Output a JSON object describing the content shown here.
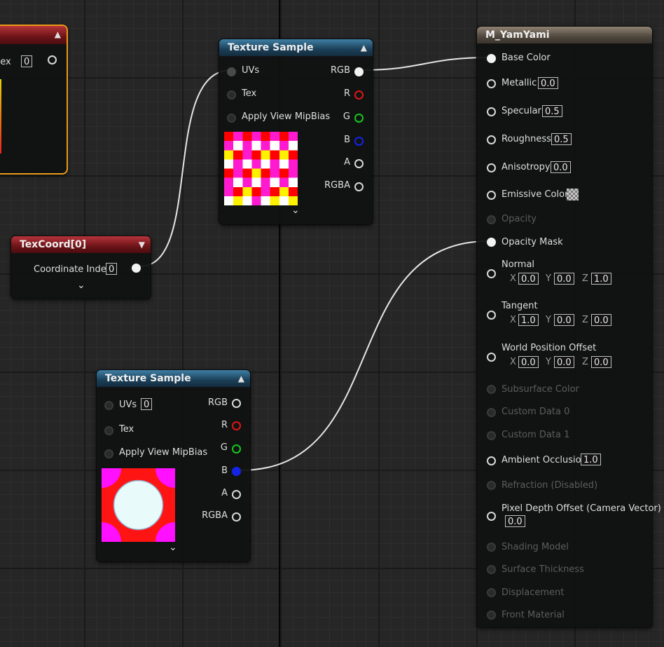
{
  "colors": {
    "grid_bg": "#262626",
    "texture_header": "#1b3f58",
    "texcoord_header": "#6c1418",
    "material_header": "#4f473e",
    "selection_outline": "#e89a1a",
    "pin_red": "#e01515",
    "pin_green": "#12c81e",
    "pin_blue": "#1424e6"
  },
  "partial_node": {
    "label_fragment": "dex",
    "value": "0"
  },
  "texture_sample_top": {
    "title": "Texture Sample",
    "inputs": [
      "UVs",
      "Tex",
      "Apply View MipBias"
    ],
    "outputs": [
      "RGB",
      "R",
      "G",
      "B",
      "A",
      "RGBA"
    ],
    "preview": "checker-pattern-red-magenta-yellow-white"
  },
  "texcoord_node": {
    "title": "TexCoord[0]",
    "label": "Coordinate Index",
    "value": "0"
  },
  "texture_sample_bottom": {
    "title": "Texture Sample",
    "inputs": [
      "UVs",
      "Tex",
      "Apply View MipBias"
    ],
    "uvs_value": "0",
    "outputs": [
      "RGB",
      "R",
      "G",
      "B",
      "A",
      "RGBA"
    ],
    "preview": "circle-pattern-red-magenta-white"
  },
  "material_node": {
    "title": "M_YamYami",
    "base_color": "Base Color",
    "metallic": {
      "label": "Metallic",
      "value": "0.0"
    },
    "specular": {
      "label": "Specular",
      "value": "0.5"
    },
    "roughness": {
      "label": "Roughness",
      "value": "0.5"
    },
    "anisotropy": {
      "label": "Anisotropy",
      "value": "0.0"
    },
    "emissive": "Emissive Color",
    "opacity": "Opacity",
    "opacity_mask": "Opacity Mask",
    "normal": {
      "label": "Normal",
      "x": "0.0",
      "y": "0.0",
      "z": "1.0"
    },
    "tangent": {
      "label": "Tangent",
      "x": "1.0",
      "y": "0.0",
      "z": "0.0"
    },
    "wpo": {
      "label": "World Position Offset",
      "x": "0.0",
      "y": "0.0",
      "z": "0.0"
    },
    "axis_x": "X",
    "axis_y": "Y",
    "axis_z": "Z",
    "subsurface": "Subsurface Color",
    "custom0": "Custom Data 0",
    "custom1": "Custom Data 1",
    "ambient_occlusion": {
      "label": "Ambient Occlusion",
      "value": "1.0"
    },
    "refraction": "Refraction (Disabled)",
    "pdo": {
      "label": "Pixel Depth Offset (Camera Vector)",
      "value": "0.0"
    },
    "shading_model": "Shading Model",
    "surface_thickness": "Surface Thickness",
    "displacement": "Displacement",
    "front_material": "Front Material"
  },
  "icons": {
    "collapse": "▲",
    "expand": "▼",
    "chevron": "⌄"
  }
}
